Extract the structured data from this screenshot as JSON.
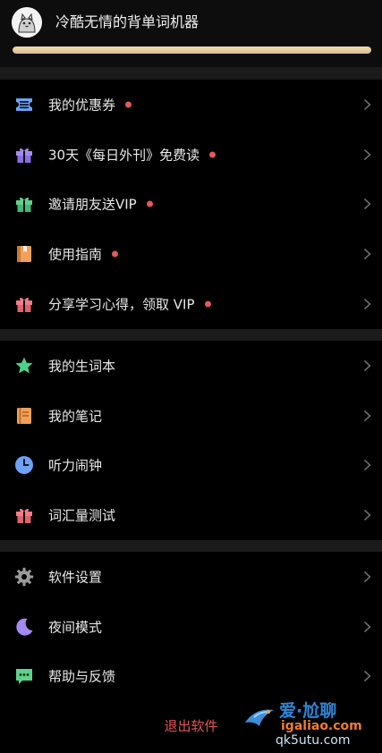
{
  "profile": {
    "name": "冷酷无情的背单词机器",
    "avatar_icon": "cat-avatar-icon",
    "progress_fraction": 1.0
  },
  "groups": [
    {
      "items": [
        {
          "name": "coupon",
          "label": "我的优惠券",
          "icon": "ticket-icon",
          "color": "#6ea2f5",
          "dot": true
        },
        {
          "name": "foreign-journal",
          "label": "30天《每日外刊》免费读",
          "icon": "gift-icon",
          "color": "#a48af0",
          "dot": true
        },
        {
          "name": "invite-vip",
          "label": "邀请朋友送VIP",
          "icon": "gift-icon",
          "color": "#5fd28a",
          "dot": true
        },
        {
          "name": "guide",
          "label": "使用指南",
          "icon": "book-icon",
          "color": "#f0a05a",
          "dot": true
        },
        {
          "name": "share-vip",
          "label": "分享学习心得，领取 VIP",
          "icon": "gift-icon",
          "color": "#f07d83",
          "dot": true
        }
      ]
    },
    {
      "items": [
        {
          "name": "new-words",
          "label": "我的生词本",
          "icon": "star-icon",
          "color": "#4fcf8a",
          "dot": false
        },
        {
          "name": "notes",
          "label": "我的笔记",
          "icon": "notebook-icon",
          "color": "#f0a05a",
          "dot": false
        },
        {
          "name": "alarm",
          "label": "听力闹钟",
          "icon": "clock-icon",
          "color": "#6ea2f5",
          "dot": false
        },
        {
          "name": "vocab-test",
          "label": "词汇量测试",
          "icon": "gift-icon",
          "color": "#f07d83",
          "dot": false
        }
      ]
    },
    {
      "items": [
        {
          "name": "settings",
          "label": "软件设置",
          "icon": "gear-icon",
          "color": "#9a9a9a",
          "dot": false
        },
        {
          "name": "night-mode",
          "label": "夜间模式",
          "icon": "moon-icon",
          "color": "#a48af0",
          "dot": false
        },
        {
          "name": "feedback",
          "label": "帮助与反馈",
          "icon": "chat-icon",
          "color": "#5fd28a",
          "dot": false
        }
      ]
    }
  ],
  "logout_label": "退出软件",
  "watermark": {
    "line1": "爱·尬聊",
    "line2": "igaliao.com",
    "line3": "qk5utu.com"
  },
  "colors": {
    "dot": "#e0595b",
    "logout": "#e05656",
    "progress": "#e8cf9f"
  }
}
